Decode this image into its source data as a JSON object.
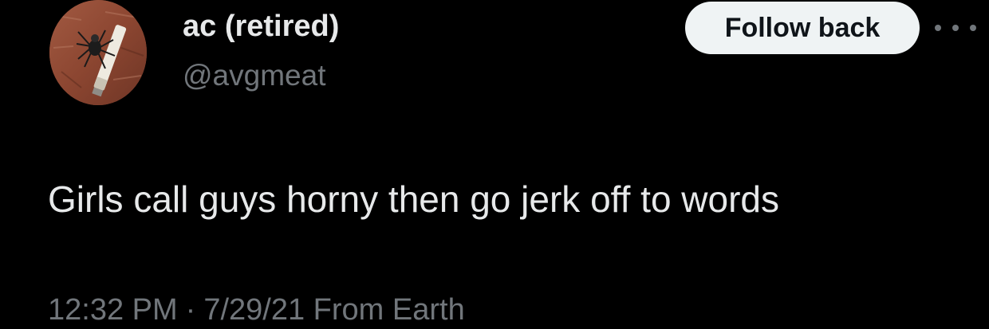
{
  "author": {
    "display_name": "ac (retired)",
    "handle": "@avgmeat",
    "avatar_icon": "spider-cigarette-avatar"
  },
  "actions": {
    "follow_label": "Follow back",
    "more_icon": "more-dots-icon"
  },
  "tweet": {
    "text": "Girls call guys horny then go jerk off to words"
  },
  "meta": {
    "time": "12:32 PM",
    "separator": "·",
    "date": "7/29/21",
    "source": "From Earth"
  },
  "colors": {
    "background": "#000000",
    "primary_text": "#e7e9ea",
    "secondary_text": "#71767b",
    "button_bg": "#eff3f4",
    "button_text": "#0f1419"
  }
}
